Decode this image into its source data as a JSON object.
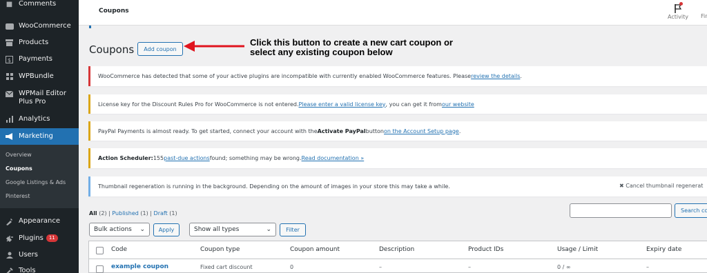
{
  "sidebar": {
    "items": [
      {
        "label": "Comments",
        "icon": "comments-icon"
      },
      {
        "label": "WooCommerce",
        "icon": "woocommerce-icon"
      },
      {
        "label": "Products",
        "icon": "products-icon"
      },
      {
        "label": "Payments",
        "icon": "payments-icon"
      },
      {
        "label": "WPBundle",
        "icon": "wpbundle-icon"
      },
      {
        "label": "WPMail Editor Plus Pro",
        "icon": "mail-icon"
      },
      {
        "label": "Analytics",
        "icon": "analytics-icon"
      },
      {
        "label": "Marketing",
        "icon": "megaphone-icon"
      },
      {
        "label": "Appearance",
        "icon": "appearance-icon"
      },
      {
        "label": "Plugins",
        "icon": "plugins-icon",
        "badge": "11"
      },
      {
        "label": "Users",
        "icon": "users-icon"
      },
      {
        "label": "Tools",
        "icon": "tools-icon"
      }
    ],
    "submenu": [
      "Overview",
      "Coupons",
      "Google Listings & Ads",
      "Pinterest"
    ]
  },
  "header": {
    "title": "Coupons",
    "activity_label": "Activity",
    "finish_label": "Fin"
  },
  "page": {
    "heading": "Coupons",
    "add_button": "Add coupon",
    "callout_line1": "Click this button to create a new cart coupon or",
    "callout_line2": "select any existing coupon below"
  },
  "notices": {
    "n1": {
      "text": "WooCommerce has detected that some of your active plugins are incompatible with currently enabled WooCommerce features. Please ",
      "link": "review the details",
      "after": "."
    },
    "n2": {
      "text": "License key for the Discount Rules Pro for WooCommerce is not entered. ",
      "link": "Please enter a valid license key",
      "mid": ", you can get it from ",
      "link2": "our website"
    },
    "n3": {
      "text": "PayPal Payments is almost ready. To get started, connect your account with the ",
      "bold": "Activate PayPal",
      "mid": " button ",
      "link": "on the Account Setup page",
      "after": "."
    },
    "n4": {
      "bold": "Action Scheduler:",
      "text": " 155 ",
      "link": "past-due actions",
      "mid": " found; something may be wrong. ",
      "link2": "Read documentation »"
    },
    "n5": {
      "text": "Thumbnail regeneration is running in the background. Depending on the amount of images in your store this may take a while.",
      "cancel": "Cancel thumbnail regenerat"
    }
  },
  "filters": {
    "all": "All",
    "all_count": "(2)",
    "sep1": " | ",
    "published": "Published",
    "published_count": "(1)",
    "sep2": " | ",
    "draft": "Draft",
    "draft_count": "(1)",
    "bulk_actions": "Bulk actions",
    "apply": "Apply",
    "show_types": "Show all types",
    "filter": "Filter",
    "search_button": "Search co"
  },
  "table": {
    "columns": [
      "Code",
      "Coupon type",
      "Coupon amount",
      "Description",
      "Product IDs",
      "Usage / Limit",
      "Expiry date"
    ],
    "rows": [
      {
        "code": "example coupon",
        "type": "Fixed cart discount",
        "amount": "0",
        "description": "–",
        "product_ids": "–",
        "usage": "0 / ∞",
        "expiry": "–"
      }
    ]
  },
  "colors": {
    "accent": "#2271b1",
    "sidebar_bg": "#1d2327",
    "error": "#d63638",
    "warning": "#dba617",
    "info": "#72aee6"
  }
}
